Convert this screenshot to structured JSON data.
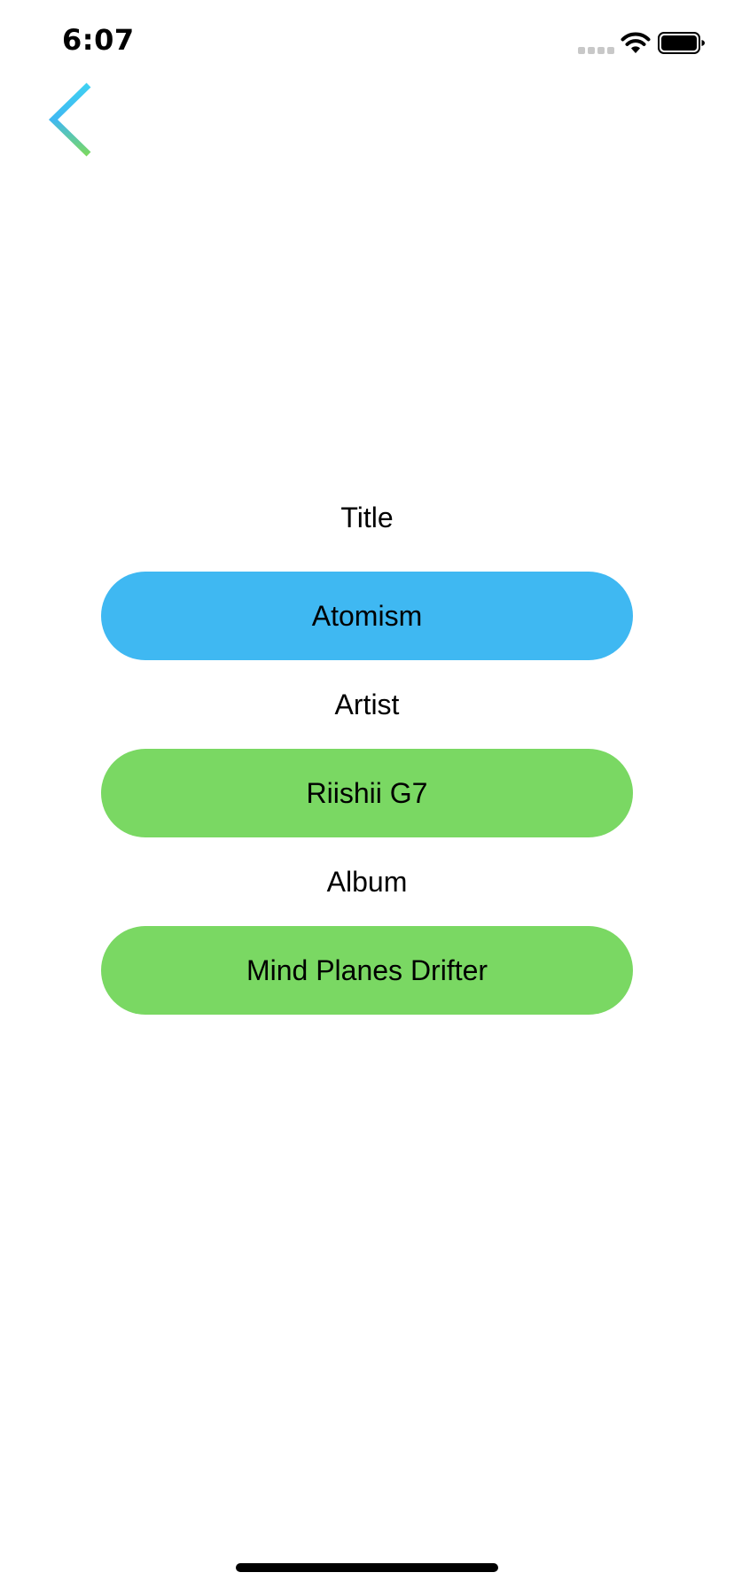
{
  "status_bar": {
    "time": "6:07",
    "icons": [
      "signal-icon",
      "wifi-icon",
      "battery-icon"
    ]
  },
  "nav": {
    "back_icon": "chevron-left-icon"
  },
  "colors": {
    "title_pill": "#3fb8f2",
    "artist_pill": "#7ad863",
    "album_pill": "#7ad863",
    "back_gradient_start": "#3fb8f2",
    "back_gradient_end": "#7ad863"
  },
  "fields": {
    "title": {
      "label": "Title",
      "value": "Atomism"
    },
    "artist": {
      "label": "Artist",
      "value": "Riishii G7"
    },
    "album": {
      "label": "Album",
      "value": "Mind Planes Drifter"
    }
  }
}
